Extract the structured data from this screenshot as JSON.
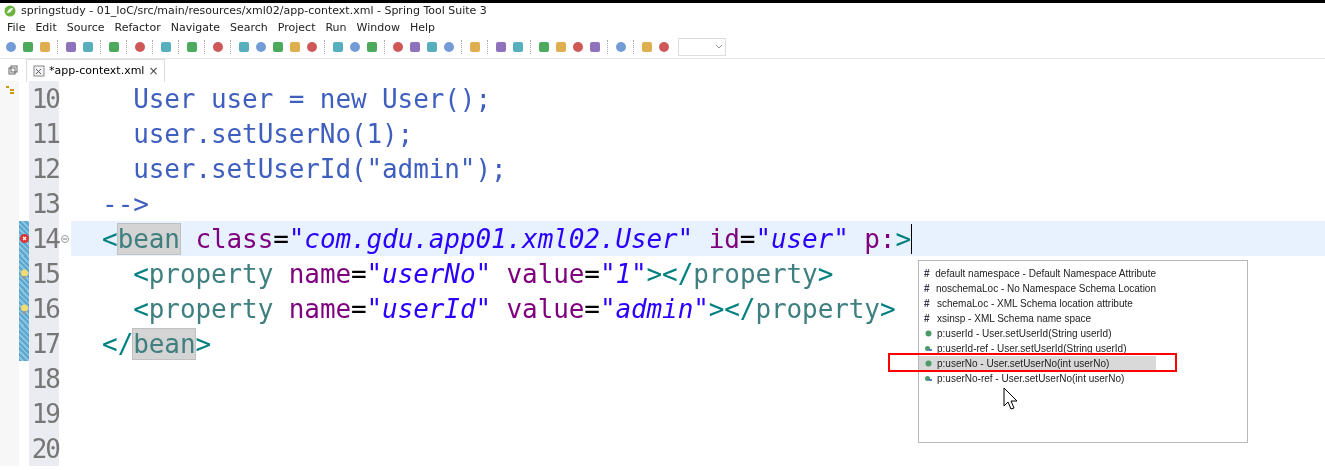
{
  "window": {
    "title": "springstudy - 01_IoC/src/main/resources/xml02/app-context.xml - Spring Tool Suite 3"
  },
  "menu": [
    "File",
    "Edit",
    "Source",
    "Refactor",
    "Navigate",
    "Search",
    "Project",
    "Run",
    "Window",
    "Help"
  ],
  "editor_tab": {
    "label": "*app-context.xml",
    "close": "×"
  },
  "lines": [
    {
      "number": "10",
      "current": false,
      "error": false,
      "warning": false,
      "changed": false,
      "tokens": [
        {
          "kind": "comment",
          "text": "    User user = new User();"
        }
      ]
    },
    {
      "number": "11",
      "current": false,
      "error": false,
      "warning": false,
      "changed": false,
      "tokens": [
        {
          "kind": "comment",
          "text": "    user.setUserNo(1);"
        }
      ]
    },
    {
      "number": "12",
      "current": false,
      "error": false,
      "warning": false,
      "changed": false,
      "tokens": [
        {
          "kind": "comment",
          "text": "    user.setUserId(\"admin\");"
        }
      ]
    },
    {
      "number": "13",
      "current": false,
      "error": false,
      "warning": false,
      "changed": false,
      "tokens": [
        {
          "kind": "comment",
          "text": "  -->"
        }
      ]
    },
    {
      "number": "14",
      "current": true,
      "error": true,
      "warning": false,
      "changed": true,
      "tokens": [
        {
          "kind": "bracket",
          "text": "  <"
        },
        {
          "kind": "tagmatch",
          "text": "bean"
        },
        {
          "kind": "attr",
          "text": " class"
        },
        {
          "kind": "plain",
          "text": "="
        },
        {
          "kind": "string",
          "text": "\"com.gdu.app01.xml02.User\""
        },
        {
          "kind": "attr",
          "text": " id"
        },
        {
          "kind": "plain",
          "text": "="
        },
        {
          "kind": "string",
          "text": "\"user\""
        },
        {
          "kind": "attr",
          "text": " p:"
        },
        {
          "kind": "bracket",
          "text": ">"
        }
      ]
    },
    {
      "number": "15",
      "current": false,
      "error": false,
      "warning": true,
      "changed": true,
      "tokens": [
        {
          "kind": "bracket",
          "text": "    <"
        },
        {
          "kind": "tag",
          "text": "property"
        },
        {
          "kind": "attr",
          "text": " name"
        },
        {
          "kind": "plain",
          "text": "="
        },
        {
          "kind": "string",
          "text": "\"userNo\""
        },
        {
          "kind": "attr",
          "text": " value"
        },
        {
          "kind": "plain",
          "text": "="
        },
        {
          "kind": "string",
          "text": "\"1\""
        },
        {
          "kind": "bracket",
          "text": "></"
        },
        {
          "kind": "tag",
          "text": "property"
        },
        {
          "kind": "bracket",
          "text": ">"
        }
      ]
    },
    {
      "number": "16",
      "current": false,
      "error": false,
      "warning": true,
      "changed": true,
      "tokens": [
        {
          "kind": "bracket",
          "text": "    <"
        },
        {
          "kind": "tag",
          "text": "property"
        },
        {
          "kind": "attr",
          "text": " name"
        },
        {
          "kind": "plain",
          "text": "="
        },
        {
          "kind": "string",
          "text": "\"userId\""
        },
        {
          "kind": "attr",
          "text": " value"
        },
        {
          "kind": "plain",
          "text": "="
        },
        {
          "kind": "string",
          "text": "\"admin\""
        },
        {
          "kind": "bracket",
          "text": "></"
        },
        {
          "kind": "tag",
          "text": "property"
        },
        {
          "kind": "bracket",
          "text": ">"
        }
      ]
    },
    {
      "number": "17",
      "current": false,
      "error": false,
      "warning": false,
      "changed": true,
      "tokens": [
        {
          "kind": "bracket",
          "text": "  </"
        },
        {
          "kind": "tagmatch",
          "text": "bean"
        },
        {
          "kind": "bracket",
          "text": ">"
        }
      ]
    },
    {
      "number": "18",
      "current": false,
      "error": false,
      "warning": false,
      "changed": false
    },
    {
      "number": "19",
      "current": false,
      "error": false,
      "warning": false,
      "changed": false
    },
    {
      "number": "20",
      "current": false,
      "error": false,
      "warning": false,
      "changed": false
    }
  ],
  "proposals": [
    {
      "kind": "namespace",
      "label": "default namespace - Default Namespace Attribute",
      "selected": false
    },
    {
      "kind": "namespace",
      "label": "noschemaLoc - No Namespace Schema Location",
      "selected": false
    },
    {
      "kind": "namespace",
      "label": "schemaLoc - XML Schema location attribute",
      "selected": false
    },
    {
      "kind": "namespace",
      "label": "xsinsp - XML Schema name space",
      "selected": false
    },
    {
      "kind": "property",
      "label": "p:userId - User.setUserId(String userId)",
      "selected": false
    },
    {
      "kind": "reference",
      "label": "p:userId-ref - User.setUserId(String userId)",
      "selected": false
    },
    {
      "kind": "property",
      "label": "p:userNo - User.setUserNo(int userNo)",
      "selected": true
    },
    {
      "kind": "reference",
      "label": "p:userNo-ref - User.setUserNo(int userNo)",
      "selected": false
    }
  ],
  "hash_symbol": "#"
}
